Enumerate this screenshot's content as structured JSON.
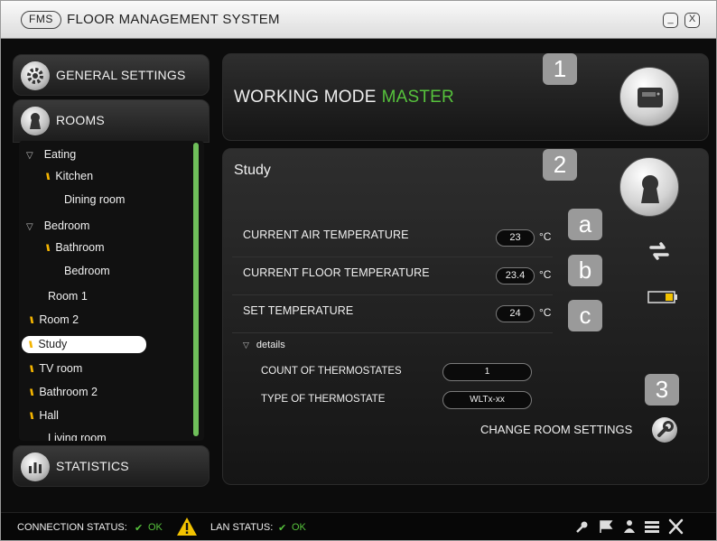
{
  "titlebar": {
    "logo": "FMS",
    "title": "FLOOR MANAGEMENT SYSTEM",
    "minimize": "_",
    "close": "X"
  },
  "sidebar": {
    "general_settings": "GENERAL SETTINGS",
    "rooms": "ROOMS",
    "statistics": "STATISTICS",
    "tree": [
      {
        "label": "Eating",
        "type": "group"
      },
      {
        "label": "Kitchen",
        "type": "heated-sub"
      },
      {
        "label": "Dining room",
        "type": "sub"
      },
      {
        "label": "Bedroom",
        "type": "group"
      },
      {
        "label": "Bathroom",
        "type": "heated-sub"
      },
      {
        "label": "Bedroom",
        "type": "sub"
      },
      {
        "label": "Room 1",
        "type": "plain"
      },
      {
        "label": "Room 2",
        "type": "heated"
      },
      {
        "label": "Study",
        "type": "heated",
        "selected": true
      },
      {
        "label": "TV room",
        "type": "heated"
      },
      {
        "label": "Bathroom 2",
        "type": "heated"
      },
      {
        "label": "Hall",
        "type": "heated"
      },
      {
        "label": "Living room",
        "type": "plain"
      }
    ]
  },
  "working_mode": {
    "badge": "1",
    "label": "WORKING MODE",
    "value": "MASTER"
  },
  "room_panel": {
    "badge": "2",
    "title": "Study",
    "rows": [
      {
        "label": "CURRENT AIR TEMPERATURE",
        "value": "23",
        "unit": "°C",
        "badge": "a"
      },
      {
        "label": "CURRENT FLOOR TEMPERATURE",
        "value": "23.4",
        "unit": "°C",
        "badge": "b"
      },
      {
        "label": "SET TEMPERATURE",
        "value": "24",
        "unit": "°C",
        "badge": "c"
      }
    ],
    "details": {
      "label": "details",
      "count_label": "COUNT OF THERMOSTATES",
      "count_value": "1",
      "type_label": "TYPE OF THERMOSTATE",
      "type_value": "WLTx-xx"
    },
    "change_badge": "3",
    "change_label": "CHANGE ROOM SETTINGS"
  },
  "statusbar": {
    "connection_label": "CONNECTION STATUS:",
    "connection_value": "OK",
    "lan_label": "LAN STATUS:",
    "lan_value": "OK"
  },
  "colors": {
    "accent_green": "#56c23c",
    "heat_orange": "#f4b400",
    "warning_yellow": "#f2c200",
    "battery_yellow": "#f2c200"
  }
}
